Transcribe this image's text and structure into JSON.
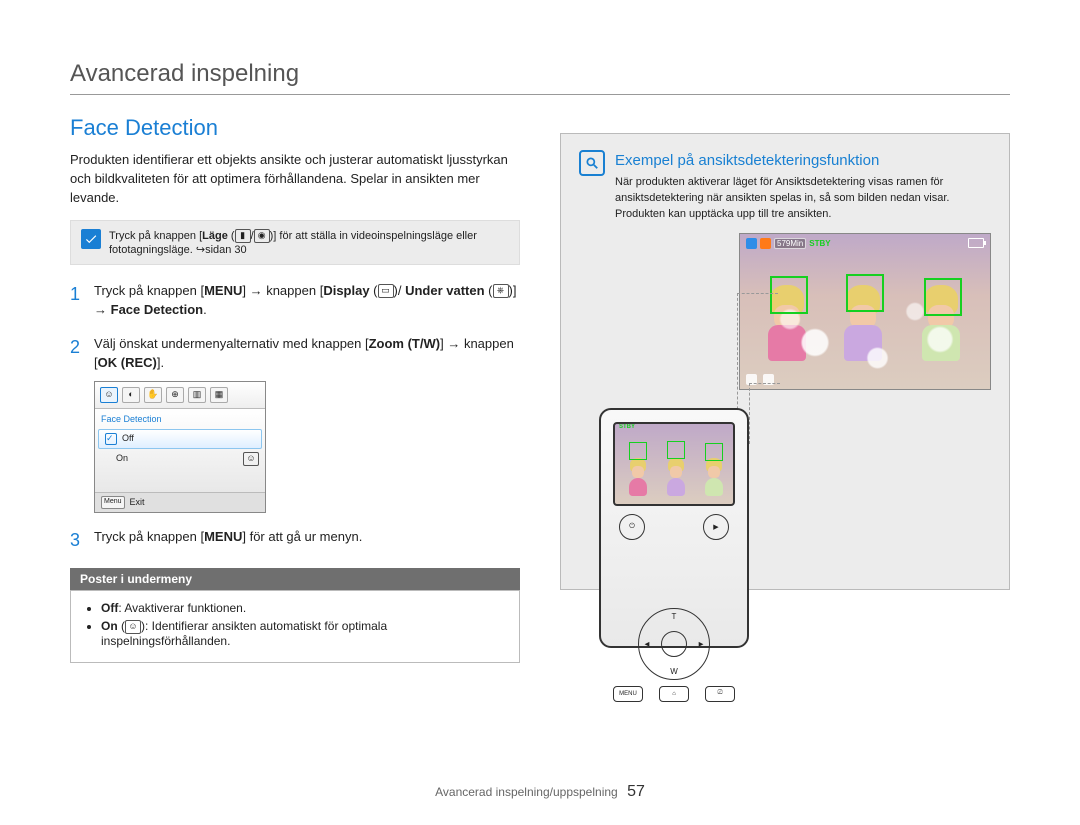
{
  "chapter": "Avancerad inspelning",
  "footer": {
    "section": "Avancerad inspelning/uppspelning",
    "page": "57"
  },
  "left": {
    "title": "Face Detection",
    "intro": "Produkten identifierar ett objekts ansikte och justerar automatiskt ljusstyrkan och bildkvaliteten för att optimera förhållandena. Spelar in ansikten mer levande.",
    "note_a": "Tryck på knappen [",
    "note_mode": "Läge",
    "note_b": " (",
    "note_c": ")] för att ställa in videoinspelningsläge eller fototagningsläge. ",
    "note_page_ref": "sidan 30",
    "step1": {
      "a": "Tryck på knappen [",
      "menu": "MENU",
      "b": "] ",
      "c": " knappen [",
      "display": "Display",
      "d": " (",
      "e": ")/",
      "under": "Under vatten",
      "f": " (",
      "g": ")] ",
      "h": " ",
      "fd": "Face Detection",
      "end": "."
    },
    "step2": {
      "a": "Välj önskat undermenyalternativ med knappen [",
      "zoom": "Zoom (T/W)",
      "b": "] ",
      "c": " knappen [",
      "ok": "OK (REC)",
      "d": "]."
    },
    "menu_shot": {
      "header": "Face Detection",
      "opt_off": "Off",
      "opt_on": "On",
      "exit_btn": "Menu",
      "exit": "Exit"
    },
    "step3": {
      "a": "Tryck på knappen [",
      "menu": "MENU",
      "b": "] för att gå ur menyn."
    },
    "submenu": {
      "title": "Poster i undermeny",
      "off_k": "Off",
      "off_t": ": Avaktiverar funktionen.",
      "on_k": "On",
      "on_t": "): Identifierar ansikten automatiskt för optimala inspelningsförhållanden.",
      "on_paren": " ("
    }
  },
  "right": {
    "title": "Exempel på ansiktsdetekteringsfunktion",
    "text": "När produkten aktiverar läget för Ansiktsdetektering visas ramen för ansiktsdetektering när ansikten spelas in, så som bilden nedan visar. Produkten kan upptäcka upp till tre ansikten.",
    "osd": {
      "time": "579Min",
      "stby": "STBY"
    }
  }
}
